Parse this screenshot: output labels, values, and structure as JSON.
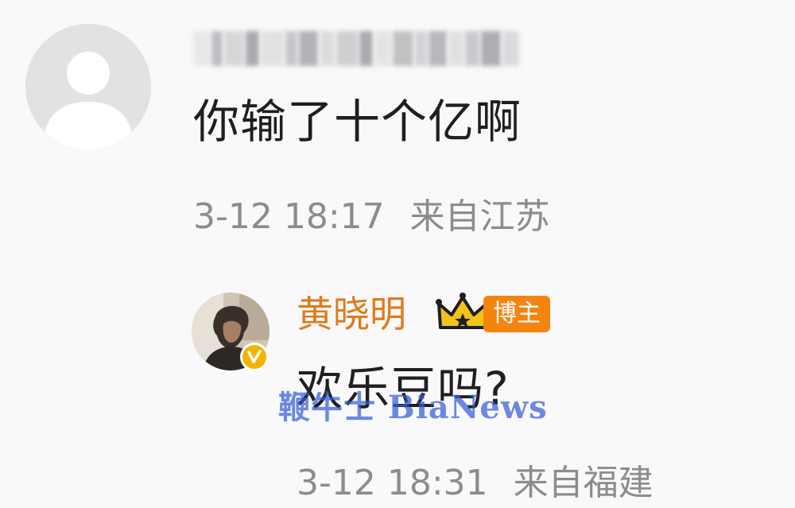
{
  "comment": {
    "author_name_blurred": "",
    "text": "你输了十个亿啊",
    "time": "3-12 18:17",
    "location": "来自江苏",
    "avatar_icon": "default-user-silhouette"
  },
  "reply": {
    "author_name": "黄晓明",
    "author_name_color": "#e07a1a",
    "crown_icon": "crown-icon",
    "role_badge": "博主",
    "role_badge_color": "#f3850f",
    "verified_icon": "verified-v-badge",
    "text": "欢乐豆吗?",
    "time": "3-12 18:31",
    "location": "来自福建"
  },
  "watermark": {
    "text": "鞭牛士 BiaNews"
  }
}
